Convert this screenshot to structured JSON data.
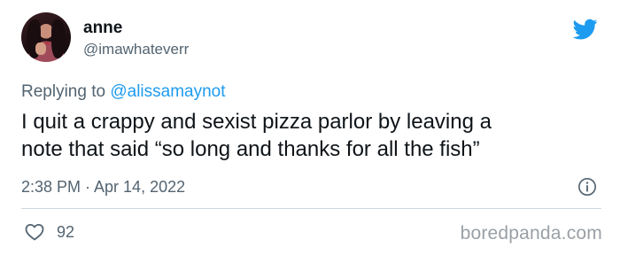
{
  "author": {
    "name": "anne",
    "handle": "@imawhateverr"
  },
  "reply": {
    "prefix": "Replying to ",
    "mention": "@alissamaynot"
  },
  "tweet": {
    "text": "I quit a crappy and sexist pizza parlor by leaving a\nnote that said “so long and thanks for all the fish”",
    "timestamp": "2:38 PM · Apr 14, 2022"
  },
  "actions": {
    "like_count": "92"
  },
  "watermark": "boredpanda.com",
  "icons": {
    "brand": "twitter-bird-icon",
    "info": "info-icon",
    "like": "heart-icon"
  },
  "colors": {
    "accent": "#1d9bf0",
    "secondary_text": "#536471",
    "primary_text": "#0f1419",
    "divider": "#cfd9de",
    "watermark": "#9aa0a6"
  }
}
